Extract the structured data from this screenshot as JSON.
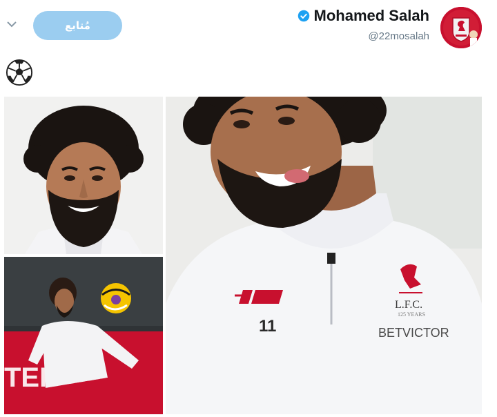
{
  "header": {
    "display_name": "Mohamed Salah",
    "handle": "@22mosalah",
    "follow_label": "مُتابع",
    "verified": true
  },
  "tweet": {
    "text_emoji": "soccer-ball-icon"
  },
  "media": {
    "photos": [
      {
        "label": "smiling-portrait"
      },
      {
        "label": "training-with-ball",
        "banner_text": "TER UN"
      },
      {
        "label": "training-closeup",
        "shirt_number": "11",
        "badge_text": "L.F.C.",
        "badge_sub": "125 YEARS",
        "sponsor": "BETVICTOR"
      }
    ]
  },
  "colors": {
    "follow_button": "#9bcdf0",
    "verified": "#1da1f2",
    "club_red": "#c8102e"
  },
  "icons": [
    "chevron-down-icon",
    "verified-badge-icon",
    "soccer-ball-icon",
    "liverpool-crest-icon"
  ]
}
